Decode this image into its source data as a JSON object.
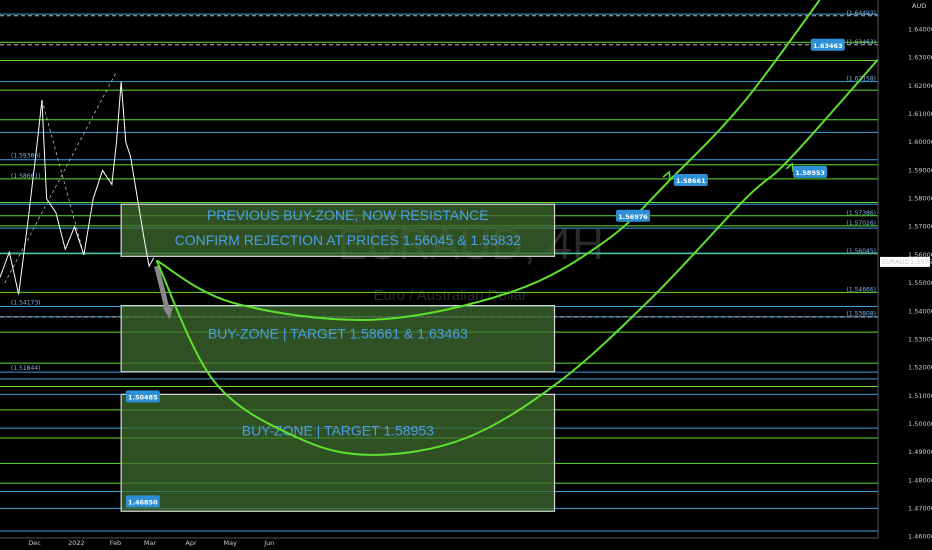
{
  "chart_data": {
    "type": "line",
    "instrument_watermark": "EURAUD, 4H",
    "instrument_subtitle": "Euro / Australian Dollar",
    "price_tag": {
      "symbol": "EURAUD",
      "value": "1.55752"
    },
    "currency_label": "AUD",
    "ylim": [
      1.4595,
      1.6505
    ],
    "y_ticks": [
      "1.46000",
      "1.47000",
      "1.48000",
      "1.49000",
      "1.50000",
      "1.51000",
      "1.52000",
      "1.53000",
      "1.54000",
      "1.55000",
      "1.56000",
      "1.57000",
      "1.58000",
      "1.59000",
      "1.60000",
      "1.61000",
      "1.62000",
      "1.63000",
      "1.64000"
    ],
    "x_ticks": [
      "Dec",
      "2022",
      "Feb",
      "Mar",
      "Apr",
      "May",
      "Jun"
    ],
    "colors": {
      "green": "#5ee02c",
      "blue": "#3aa0e0",
      "zone_fill": "#3f6b2f",
      "zone_border": "#d8d8d8",
      "price": "#ffffff",
      "badge": "#2d8fd6"
    },
    "green_levels": [
      1.6355,
      1.629,
      1.6185,
      1.608,
      1.592,
      1.587,
      1.5786,
      1.5739,
      1.5703,
      1.5604,
      1.5467,
      1.5326,
      1.5216,
      1.5133,
      1.505,
      1.495,
      1.486,
      1.479
    ],
    "blue_levels": [
      1.6455,
      1.6215,
      1.6035,
      1.5938,
      1.578,
      1.5695,
      1.5607,
      1.5417,
      1.538,
      1.5184,
      1.516,
      1.5105,
      1.4985,
      1.476,
      1.47,
      1.462
    ],
    "dashed_levels": [
      1.6449,
      1.6346,
      1.538
    ],
    "left_level_labels": [
      {
        "text": "(1.59380)",
        "y": 1.5938
      },
      {
        "text": "(1.58661)",
        "y": 1.5866
      },
      {
        "text": "(1.54173)",
        "y": 1.5417
      },
      {
        "text": "(1.51844)",
        "y": 1.5184
      }
    ],
    "right_level_labels": [
      {
        "text": "(1.64493)",
        "y": 1.6449
      },
      {
        "text": "(1.63463)",
        "y": 1.6346
      },
      {
        "text": "(1.62158)",
        "y": 1.6216
      },
      {
        "text": "(1.57386)",
        "y": 1.5739
      },
      {
        "text": "(1.57026)",
        "y": 1.5703
      },
      {
        "text": "(1.56045)",
        "y": 1.5604
      },
      {
        "text": "(1.54666)",
        "y": 1.5467
      },
      {
        "text": "(1.53808)",
        "y": 1.5381
      }
    ],
    "zones": [
      {
        "label_lines": [
          "PREVIOUS BUY-ZONE, NOW RESISTANCE",
          "CONFIRM REJECTION AT PRICES 1.56045 & 1.55832"
        ],
        "top": 1.578,
        "bottom": 1.5595
      },
      {
        "label_lines": [
          "BUY-ZONE | TARGET 1.58661 & 1.63463"
        ],
        "top": 1.542,
        "bottom": 1.5185
      },
      {
        "label_lines": [
          "BUY-ZONE | TARGET 1.58953"
        ],
        "top": 1.5105,
        "bottom": 1.469
      }
    ],
    "badges": [
      {
        "text": "1.63463",
        "y": 1.6346,
        "x": 0.885
      },
      {
        "text": "1.58661",
        "y": 1.5866,
        "x": 0.738
      },
      {
        "text": "1.56976",
        "y": 1.5739,
        "x": 0.676
      },
      {
        "text": "1.58953",
        "y": 1.5895,
        "x": 0.866
      },
      {
        "text": "1.50485",
        "y": 1.5098,
        "x": 0.15
      },
      {
        "text": "1.46850",
        "y": 1.4725,
        "x": 0.15
      }
    ],
    "projection_1": [
      [
        0.168,
        1.558
      ],
      [
        0.25,
        1.543
      ],
      [
        0.4,
        1.537
      ],
      [
        0.55,
        1.547
      ],
      [
        0.65,
        1.565
      ],
      [
        0.72,
        1.587
      ],
      [
        0.8,
        1.615
      ],
      [
        0.9,
        1.66
      ]
    ],
    "projection_2": [
      [
        0.168,
        1.558
      ],
      [
        0.23,
        1.515
      ],
      [
        0.32,
        1.495
      ],
      [
        0.4,
        1.489
      ],
      [
        0.5,
        1.495
      ],
      [
        0.6,
        1.515
      ],
      [
        0.7,
        1.545
      ],
      [
        0.8,
        1.58
      ],
      [
        0.85,
        1.595
      ],
      [
        0.97,
        1.64
      ]
    ],
    "price_series": [
      [
        0.0,
        1.552
      ],
      [
        0.01,
        1.561
      ],
      [
        0.02,
        1.546
      ],
      [
        0.03,
        1.572
      ],
      [
        0.04,
        1.6
      ],
      [
        0.045,
        1.615
      ],
      [
        0.05,
        1.58
      ],
      [
        0.06,
        1.575
      ],
      [
        0.07,
        1.562
      ],
      [
        0.08,
        1.57
      ],
      [
        0.09,
        1.56
      ],
      [
        0.1,
        1.58
      ],
      [
        0.11,
        1.59
      ],
      [
        0.12,
        1.585
      ],
      [
        0.125,
        1.6
      ],
      [
        0.13,
        1.6215
      ],
      [
        0.135,
        1.6
      ],
      [
        0.14,
        1.595
      ],
      [
        0.145,
        1.585
      ],
      [
        0.15,
        1.575
      ],
      [
        0.155,
        1.565
      ],
      [
        0.16,
        1.556
      ],
      [
        0.165,
        1.559
      ]
    ],
    "guide_lines": [
      [
        [
          0.005,
          1.55
        ],
        [
          0.125,
          1.625
        ]
      ],
      [
        [
          0.045,
          1.615
        ],
        [
          0.09,
          1.56
        ]
      ]
    ],
    "arrow_down": [
      [
        0.168,
        1.556
      ],
      [
        0.18,
        1.54
      ]
    ]
  }
}
